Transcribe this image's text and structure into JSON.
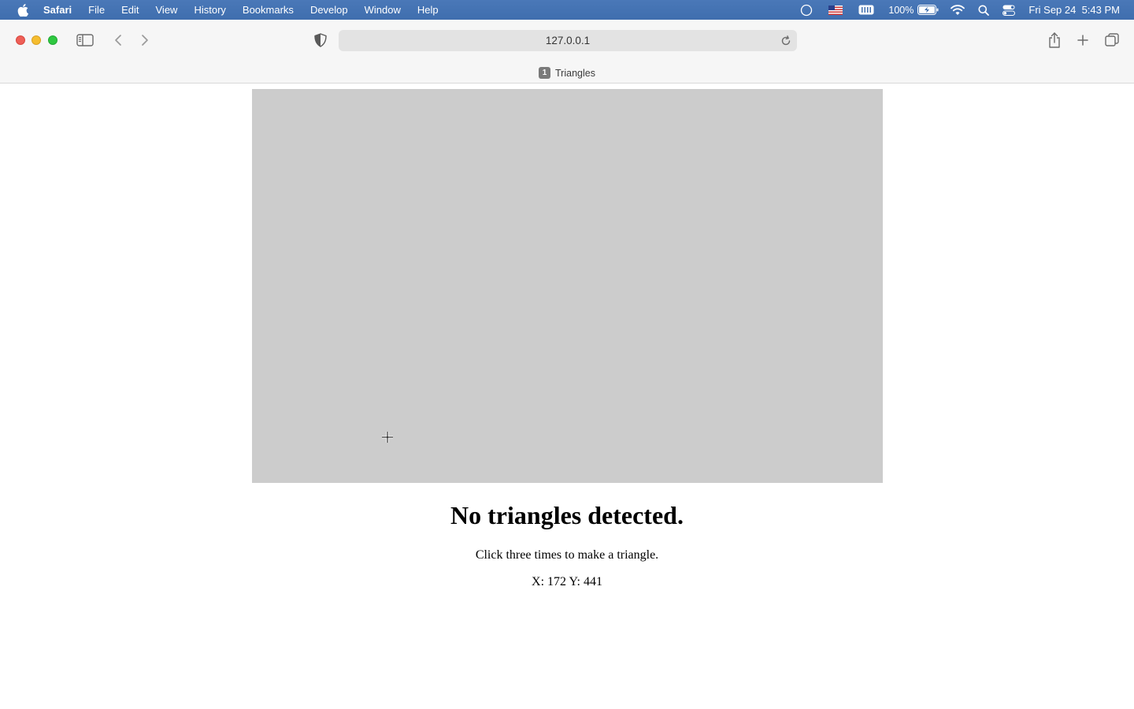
{
  "menubar": {
    "app_name": "Safari",
    "menus": [
      "File",
      "Edit",
      "View",
      "History",
      "Bookmarks",
      "Develop",
      "Window",
      "Help"
    ],
    "battery": "100%",
    "clock": "Fri Sep 24  5:43 PM"
  },
  "toolbar": {
    "url": "127.0.0.1"
  },
  "tab": {
    "count": "1",
    "title": "Triangles"
  },
  "page": {
    "headline": "No triangles detected.",
    "instruction": "Click three times to make a triangle.",
    "coords": "X: 172 Y: 441"
  },
  "colors": {
    "canvas_bg": "#cccccc",
    "menubar_bg": "#4674b4"
  }
}
